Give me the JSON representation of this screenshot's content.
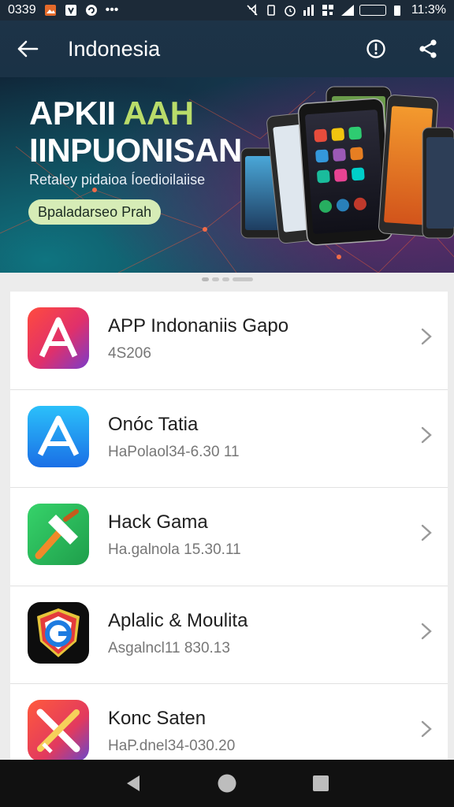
{
  "status": {
    "time_left": "0339",
    "time_right": "11:3%"
  },
  "app_bar": {
    "title": "Indonesia"
  },
  "banner": {
    "title_line1_a": "APKII ",
    "title_line1_b": "AAH",
    "title_line2": "IINPUONISAN",
    "subtitle": "Retaley pidaioa Íoedioilaiise",
    "cta": "Bpaladarseo Prah"
  },
  "apps": [
    {
      "name": "APP Indonaniis Gapo",
      "meta": "4S206",
      "icon": "red-a-icon"
    },
    {
      "name": "Onóc Tatia",
      "meta": "HaPolaol34-6.30 11",
      "icon": "blue-a-icon"
    },
    {
      "name": "Hack Gama",
      "meta": "Ha.galnola 15.30.11",
      "icon": "hammer-icon"
    },
    {
      "name": "Aplalic & Moulita",
      "meta": "Asgalncl11 830.13",
      "icon": "shield-g-icon"
    },
    {
      "name": "Konc Saten",
      "meta": "HaP.dnel34-030.20",
      "icon": "cross-tools-icon"
    }
  ],
  "colors": {
    "accent": "#b9dc6a",
    "app_bar": "#1d3347",
    "cta_bg": "#d6ecb6"
  }
}
